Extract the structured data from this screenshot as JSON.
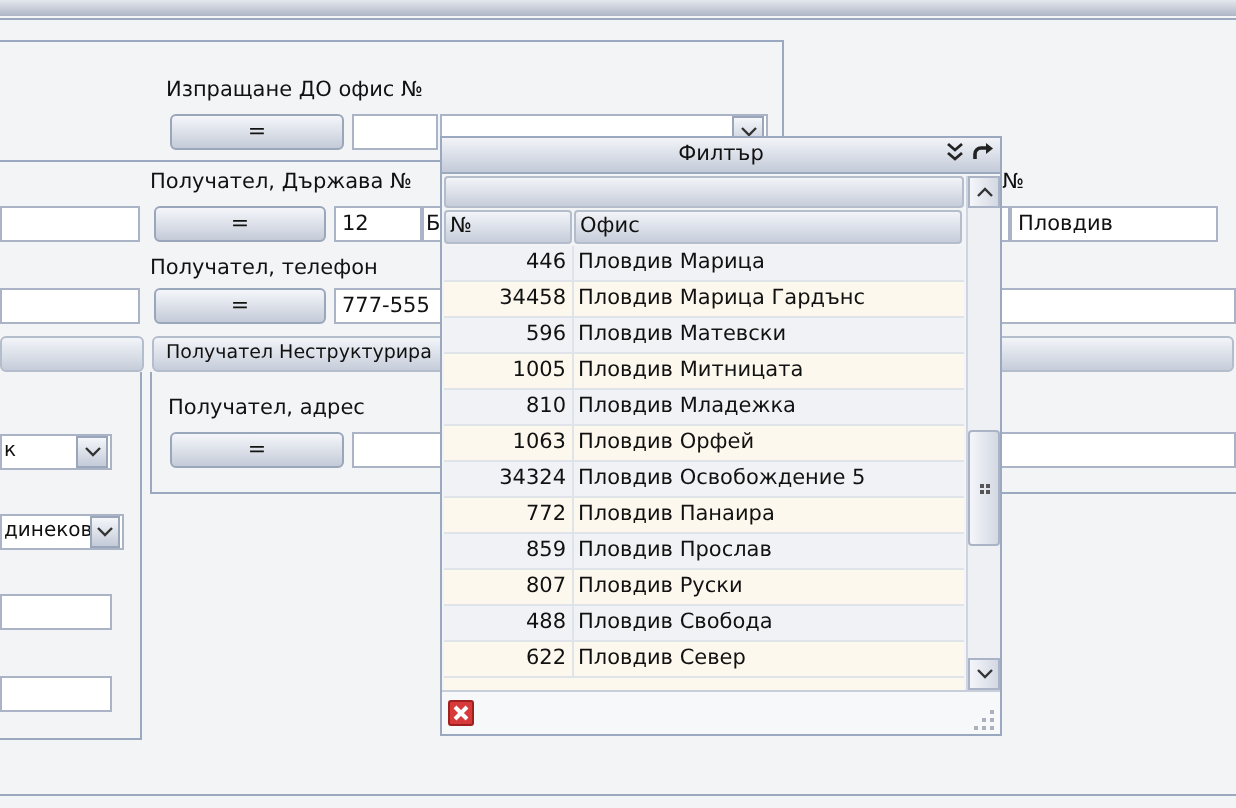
{
  "form": {
    "send_to_office": {
      "label": "Изпращане ДО офис №",
      "operator_button": "="
    },
    "recipient_country": {
      "label": "Получател, Държава №",
      "operator_button": "=",
      "code_value": "12",
      "name_value": "Б"
    },
    "right_column": {
      "label_fragment": "№",
      "city_value": "Пловдив"
    },
    "recipient_phone": {
      "label": "Получател, телефон",
      "operator_button": "=",
      "value": "777-555"
    },
    "left_panel": {
      "combos": [
        {
          "value": "к"
        },
        {
          "value": "динеков"
        }
      ]
    },
    "unstructured_section": {
      "title": "Получател Неструктурира",
      "address_label": "Получател, адрес",
      "operator_button": "="
    }
  },
  "filter_popup": {
    "title": "Филтър",
    "columns": [
      "№",
      "Офис"
    ],
    "rows": [
      {
        "number": "446",
        "office": "Пловдив Марица"
      },
      {
        "number": "34458",
        "office": "Пловдив Марица Гардънс"
      },
      {
        "number": "596",
        "office": "Пловдив Матевски"
      },
      {
        "number": "1005",
        "office": "Пловдив Митницата"
      },
      {
        "number": "810",
        "office": "Пловдив Младежка"
      },
      {
        "number": "1063",
        "office": "Пловдив Орфей"
      },
      {
        "number": "34324",
        "office": "Пловдив Освобождение 5"
      },
      {
        "number": "772",
        "office": "Пловдив Панаира"
      },
      {
        "number": "859",
        "office": "Пловдив Прослав"
      },
      {
        "number": "807",
        "office": "Пловдив Руски"
      },
      {
        "number": "488",
        "office": "Пловдив Свобода"
      },
      {
        "number": "622",
        "office": "Пловдив Север"
      }
    ]
  }
}
